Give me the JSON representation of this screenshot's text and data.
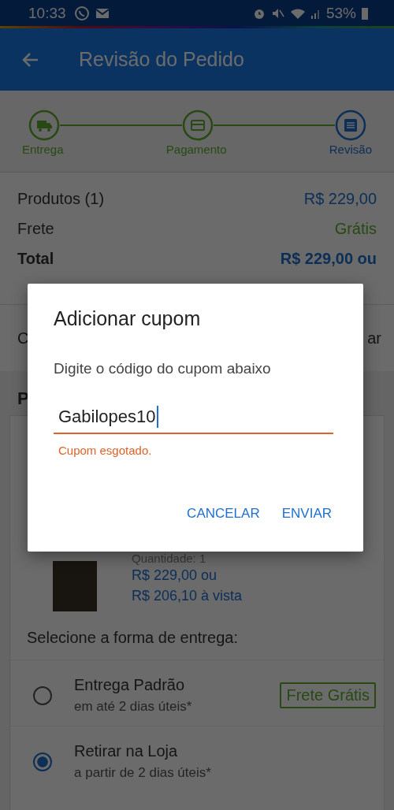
{
  "status_bar": {
    "time": "10:33",
    "battery": "53%"
  },
  "app_bar": {
    "title": "Revisão do Pedido"
  },
  "steps": [
    {
      "label": "Entrega",
      "kind": "truck",
      "selected": false
    },
    {
      "label": "Pagamento",
      "kind": "card",
      "selected": false
    },
    {
      "label": "Revisão",
      "kind": "list",
      "selected": true
    }
  ],
  "summary": [
    {
      "label": "Produtos (1)",
      "value": "R$ 229,00",
      "kind": "price"
    },
    {
      "label": "Frete",
      "value": "Grátis",
      "kind": "free"
    },
    {
      "label": "Total",
      "value": "R$ 229,00 ou",
      "kind": "total"
    }
  ],
  "coupon_row": {
    "label": "C",
    "action": "ar"
  },
  "section": {
    "title": "P"
  },
  "product": {
    "quantity": "Quantidade: 1",
    "price": "R$ 229,00 ou",
    "cash_price": "R$ 206,10 à vista"
  },
  "delivery": {
    "title": "Selecione a forma de entrega:",
    "options": [
      {
        "name": "Entrega Padrão",
        "time": "em até 2 dias úteis*",
        "badge": "Frete Grátis",
        "selected": false
      },
      {
        "name": "Retirar na Loja",
        "time": "a partir de 2 dias úteis*",
        "selected": true
      }
    ]
  },
  "dialog": {
    "title": "Adicionar cupom",
    "message": "Digite o código do cupom abaixo",
    "input": {
      "value": "Gabilopes10",
      "error": "Cupom esgotado."
    },
    "buttons": [
      "CANCELAR",
      "ENVIAR"
    ]
  }
}
